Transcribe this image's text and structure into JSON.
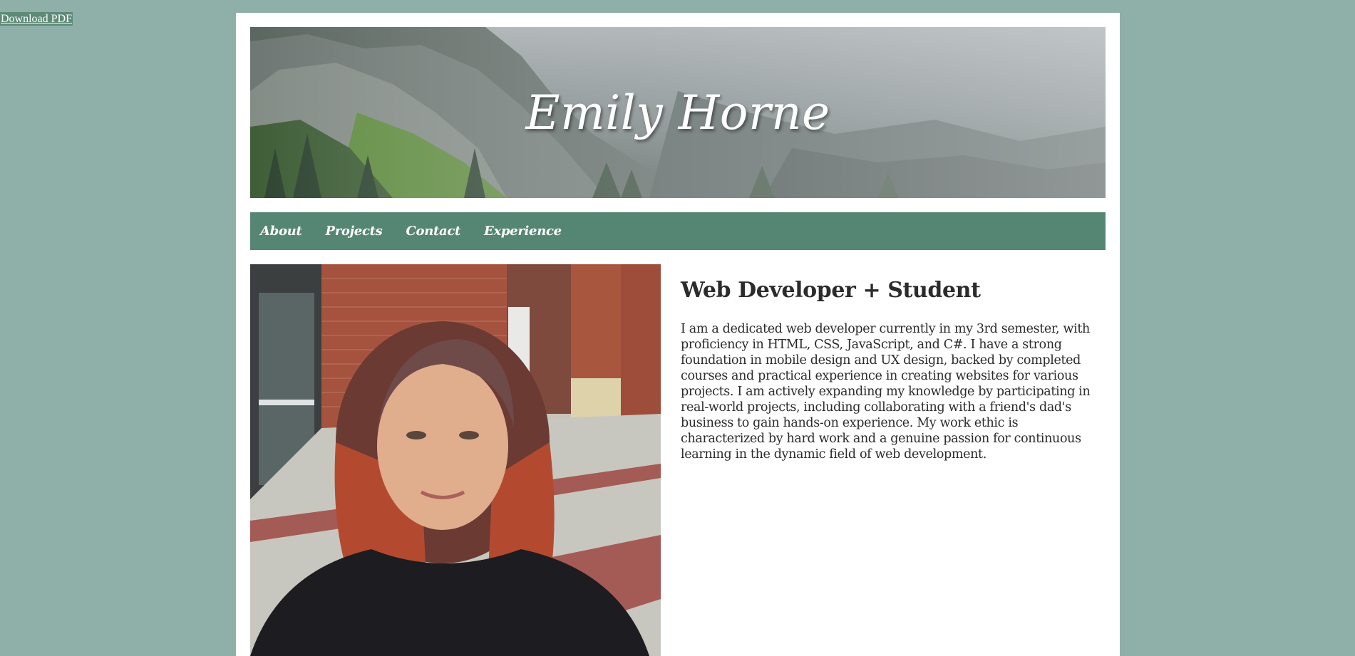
{
  "download": {
    "label": "Download PDF"
  },
  "header": {
    "name": "Emily Horne"
  },
  "nav": {
    "items": [
      {
        "label": "About"
      },
      {
        "label": "Projects"
      },
      {
        "label": "Contact"
      },
      {
        "label": "Experience"
      }
    ]
  },
  "main": {
    "heading": "Web Developer + Student",
    "bio": "I am a dedicated web developer currently in my 3rd semester, with proficiency in HTML, CSS, JavaScript, and C#. I have a strong foundation in mobile design and UX design, backed by completed courses and practical experience in creating websites for various projects. I am actively expanding my knowledge by participating in real-world projects, including collaborating with a friend's dad's business to gain hands-on experience. My work ethic is characterized by hard work and a genuine passion for continuous learning in the dynamic field of web development."
  },
  "colors": {
    "page_background": "#8fb0a8",
    "nav_background": "#558673",
    "card_background": "#ffffff",
    "text": "#2b2b2b"
  }
}
